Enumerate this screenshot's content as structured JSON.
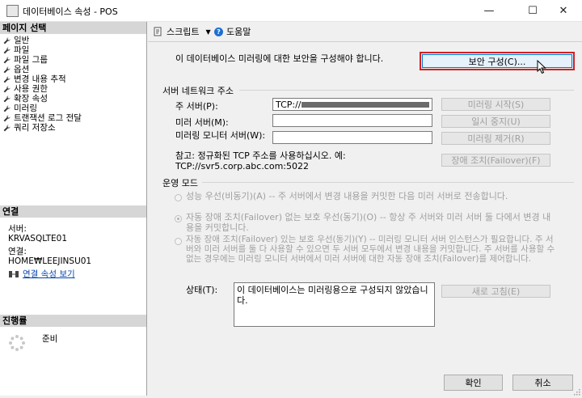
{
  "window": {
    "title": "데이터베이스 속성 - POS",
    "minimize_glyph": "—",
    "maximize_glyph": "☐",
    "close_glyph": "✕"
  },
  "left": {
    "select_page_header": "페이지 선택",
    "pages": [
      "일반",
      "파일",
      "파일 그룹",
      "옵션",
      "변경 내용 추적",
      "사용 권한",
      "확장 속성",
      "미러링",
      "트랜잭션 로그 전달",
      "쿼리 저장소"
    ],
    "connection_header": "연결",
    "server_label": "서버:",
    "server_value": "KRVASQLTE01",
    "connection_label": "연결:",
    "connection_value": "HOME₩LEEJINSU01",
    "view_connection_props": "연결 속성 보기",
    "progress_header": "진행률",
    "progress_status": "준비"
  },
  "toolbar": {
    "script_label": "스크립트",
    "help_label": "도움말"
  },
  "main": {
    "intro_text": "이 데이터베이스 미러링에 대한 보안을 구성해야 합니다.",
    "configure_security_button": "보안 구성(C)...",
    "server_network_section": "서버 네트워크 주소",
    "principal_label": "주 서버(P):",
    "principal_value": "TCP://",
    "mirror_label": "미러 서버(M):",
    "witness_label": "미러링 모니터 서버(W):",
    "start_mirroring_button": "미러링 시작(S)",
    "pause_button": "일시 중지(U)",
    "remove_mirroring_button": "미러링 제거(R)",
    "failover_button": "장애 조치(Failover)(F)",
    "note_text": "참고: 정규화된 TCP 주소를 사용하십시오. 예: TCP://svr5.corp.abc.com:5022",
    "operating_mode_section": "운영 모드",
    "modes": [
      "성능 우선(비동기)(A) -- 주 서버에서 변경 내용을 커밋한 다음 미러 서버로 전송합니다.",
      "자동 장애 조치(Failover) 없는 보호 우선(동기)(O) -- 항상 주 서버와 미러 서버 둘 다에서 변경 내용을 커밋합니다.",
      "자동 장애 조치(Failover) 있는 보호 우선(동기)(Y) -- 미러링 모니터 서버 인스턴스가 필요합니다. 주 서버와 미러 서버를 둘 다 사용할 수 있으면 두 서버 모두에서 변경 내용을 커밋합니다. 주 서버를 사용할 수 없는 경우에는 미러링 모니터 서버에서 미러 서버에 대한 자동 장애 조치(Failover)를 제어합니다."
    ],
    "selected_mode": 1,
    "status_label": "상태(T):",
    "status_text": "이 데이터베이스는 미러링용으로 구성되지 않았습니다.",
    "refresh_button": "새로 고침(E)"
  },
  "footer": {
    "ok_button": "확인",
    "cancel_button": "취소"
  }
}
